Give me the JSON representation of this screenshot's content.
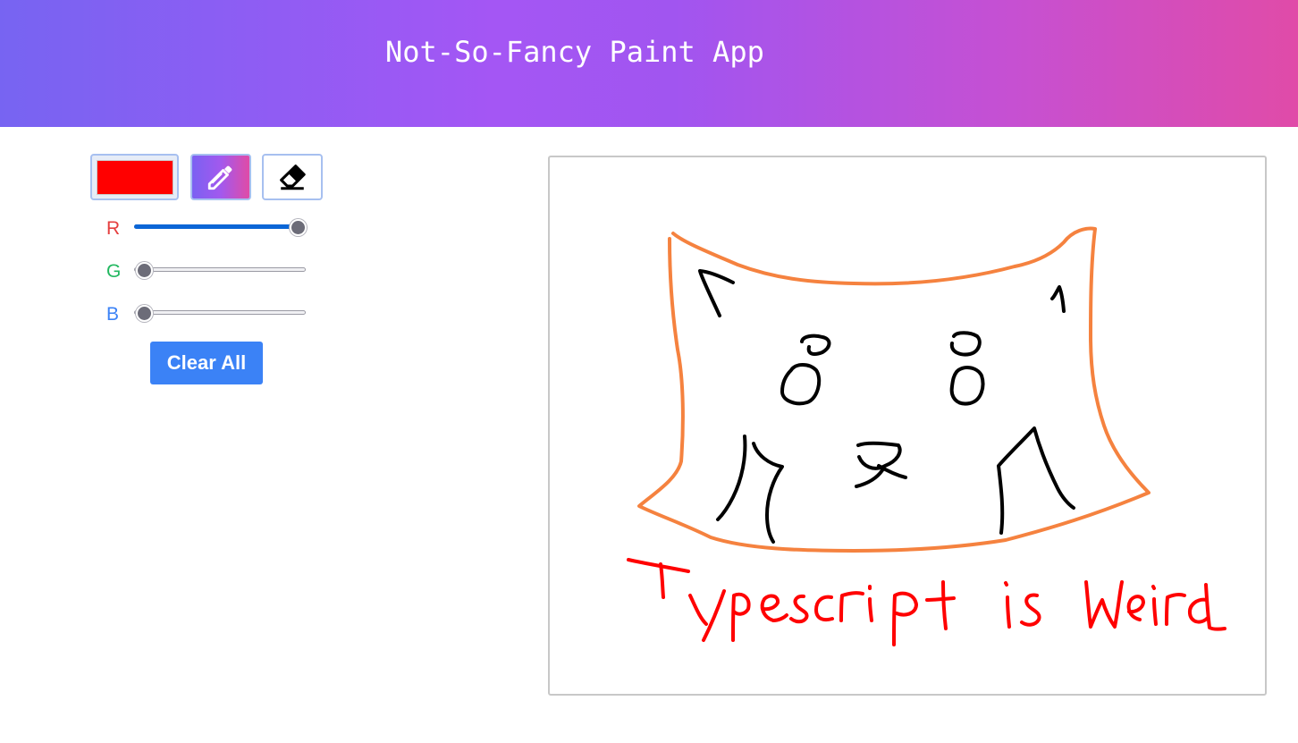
{
  "app": {
    "title": "Not-So-Fancy Paint App"
  },
  "toolbar": {
    "selected_color": "#ff0000",
    "active_tool": "pencil",
    "tools": [
      {
        "name": "color-picker",
        "icon": "color-swatch"
      },
      {
        "name": "pencil",
        "icon": "pencil-icon"
      },
      {
        "name": "eraser",
        "icon": "eraser-icon"
      }
    ],
    "clear_label": "Clear All"
  },
  "sliders": [
    {
      "key": "r",
      "label": "R",
      "value": 255,
      "max": 255,
      "color": "#e53e3e"
    },
    {
      "key": "g",
      "label": "G",
      "value": 0,
      "max": 255,
      "color": "#22b860"
    },
    {
      "key": "b",
      "label": "B",
      "value": 0,
      "max": 255,
      "color": "#3b82f6"
    }
  ],
  "canvas": {
    "drawing_text": "Typescript is Weird",
    "stroke_colors": {
      "cat_outline": "#f5823f",
      "cat_features": "#000000",
      "text": "#ff0000"
    }
  }
}
